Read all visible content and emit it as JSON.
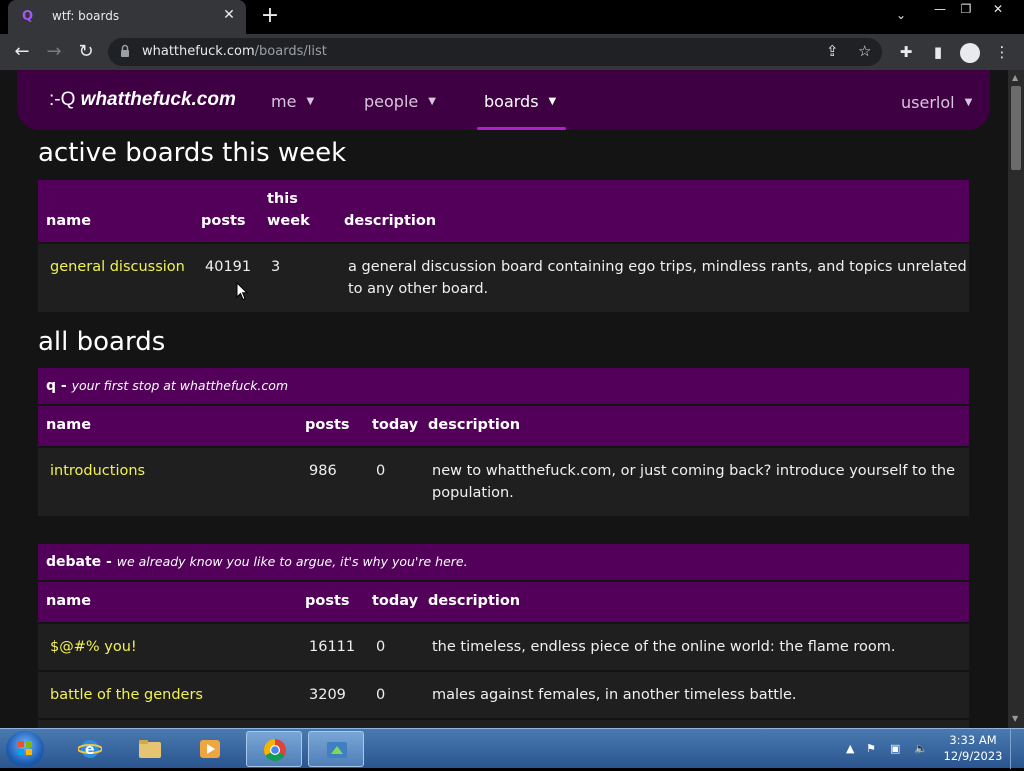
{
  "browser": {
    "tab_title": "wtf: boards",
    "tab_favicon": "Q",
    "tab_close": "✕",
    "new_tab": "+",
    "url_host": "whatthefuck.com",
    "url_path": "/boards/list",
    "tab_search": "⌄",
    "win_min": "—",
    "win_restore": "❐",
    "win_close": "✕"
  },
  "site": {
    "logo_prefix": ":-Q",
    "logo_name": "whatthefuck.com",
    "nav": {
      "me": "me",
      "people": "people",
      "boards": "boards",
      "user": "userlol",
      "caret": "▼"
    }
  },
  "active": {
    "heading": "active boards this week",
    "columns": {
      "name": "name",
      "posts": "posts",
      "this_week_1": "this",
      "this_week_2": "week",
      "description": "description"
    },
    "rows": [
      {
        "name": "general discussion",
        "posts": "40191",
        "this_week": "3",
        "desc_line1": "a general discussion board containing ego trips, mindless rants, and topics unrelated",
        "desc_line2": "to any other board."
      }
    ]
  },
  "all": {
    "heading": "all boards",
    "columns": {
      "name": "name",
      "posts": "posts",
      "today": "today",
      "description": "description"
    },
    "categories": [
      {
        "name": "q -",
        "tagline": "your first stop at whatthefuck.com",
        "rows": [
          {
            "name": "introductions",
            "posts": "986",
            "today": "0",
            "desc_line1": "new to whatthefuck.com, or just coming back? introduce yourself to the",
            "desc_line2": "population."
          }
        ]
      },
      {
        "name": "debate -",
        "tagline": "we already know you like to argue, it's why you're here.",
        "rows": [
          {
            "name": "$@#% you!",
            "posts": "16111",
            "today": "0",
            "desc_line1": "the timeless, endless piece of the online world: the flame room."
          },
          {
            "name": "battle of the genders",
            "posts": "3209",
            "today": "0",
            "desc_line1": "males against females, in another timeless battle."
          }
        ]
      }
    ]
  },
  "taskbar": {
    "time": "3:33 AM",
    "date": "12/9/2023",
    "tray_up": "▲"
  },
  "colors": {
    "accent_purple": "#52005a",
    "nav_purple": "#3e0042",
    "link_yellow": "#f2f251"
  }
}
